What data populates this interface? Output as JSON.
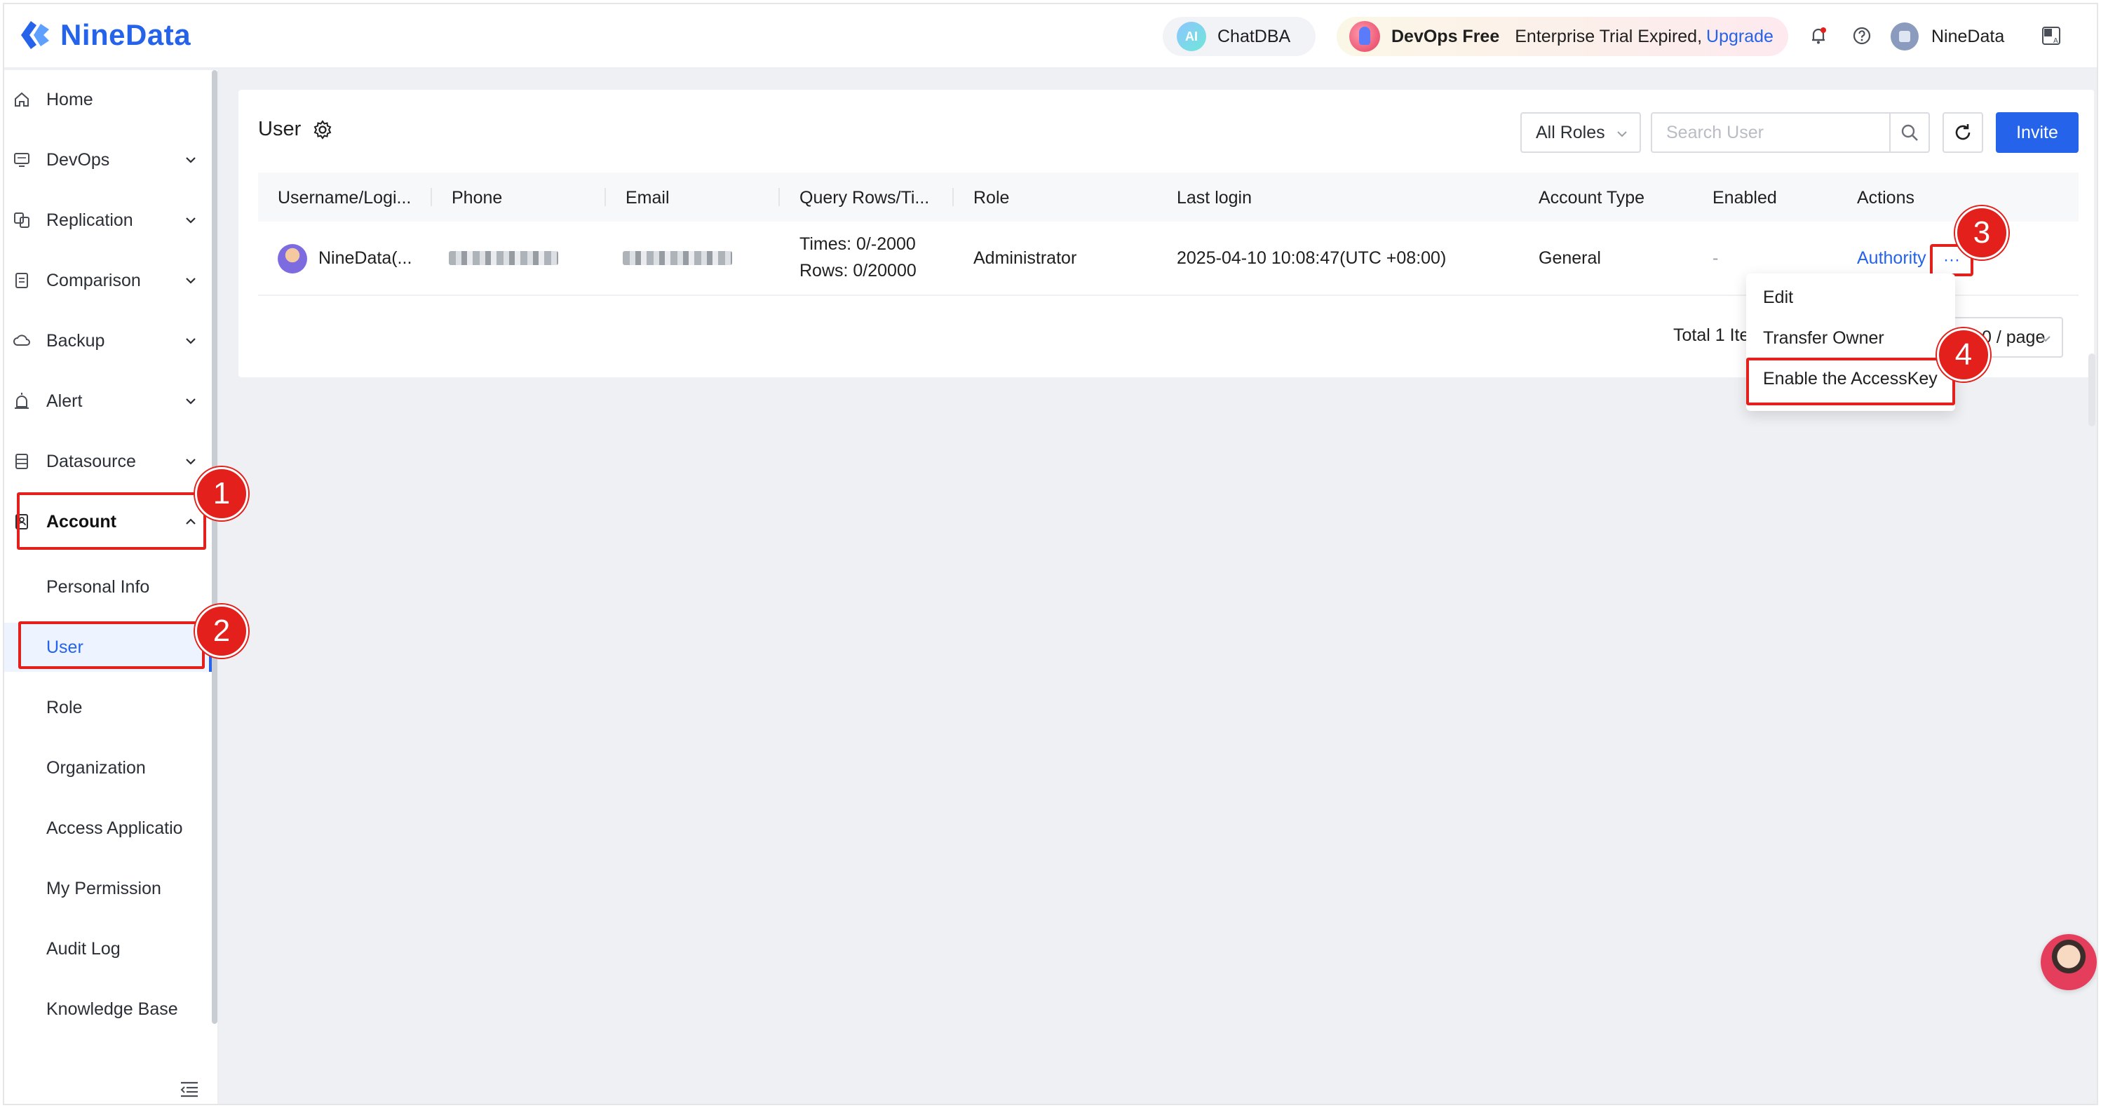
{
  "header": {
    "logo_text": "NineData",
    "chatdba_label": "ChatDBA",
    "ai_badge": "AI",
    "devops_plan": "DevOps Free",
    "trial_text": "Enterprise Trial Expired,",
    "upgrade_label": "Upgrade",
    "user_name": "NineData"
  },
  "sidebar": {
    "items": [
      {
        "label": "Home"
      },
      {
        "label": "DevOps"
      },
      {
        "label": "Replication"
      },
      {
        "label": "Comparison"
      },
      {
        "label": "Backup"
      },
      {
        "label": "Alert"
      },
      {
        "label": "Datasource"
      },
      {
        "label": "Account"
      }
    ],
    "sub_items": [
      {
        "label": "Personal Info"
      },
      {
        "label": "User"
      },
      {
        "label": "Role"
      },
      {
        "label": "Organization"
      },
      {
        "label": "Access Applicatio"
      },
      {
        "label": "My Permission"
      },
      {
        "label": "Audit Log"
      },
      {
        "label": "Knowledge Base"
      }
    ],
    "selected": "User"
  },
  "main": {
    "title": "User",
    "roles_filter": "All Roles",
    "search_placeholder": "Search User",
    "invite_label": "Invite",
    "columns": [
      "Username/Logi...",
      "Phone",
      "Email",
      "Query Rows/Ti...",
      "Role",
      "Last login",
      "Account Type",
      "Enabled",
      "Actions"
    ],
    "row": {
      "username": "NineData(...",
      "query_times": "Times:  0/-2000",
      "query_rows": "Rows:  0/20000",
      "role": "Administrator",
      "last_login": "2025-04-10 10:08:47(UTC +08:00)",
      "account_type": "General",
      "enabled": "-",
      "action_authority": "Authority",
      "action_more": "···"
    },
    "pagination_total": "Total 1 Ite",
    "page_size": "0 / page"
  },
  "dropdown": {
    "items": [
      "Edit",
      "Transfer Owner",
      "Enable the AccessKey"
    ]
  },
  "callouts": [
    "1",
    "2",
    "3",
    "4"
  ],
  "colors": {
    "accent": "#2563eb",
    "highlight": "#e3201b"
  }
}
